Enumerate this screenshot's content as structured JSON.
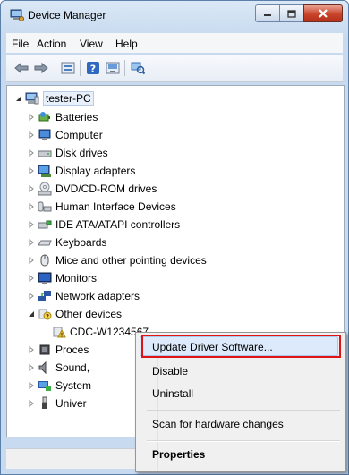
{
  "window": {
    "title": "Device Manager"
  },
  "menubar": [
    {
      "label": "File"
    },
    {
      "label": "Action"
    },
    {
      "label": "View"
    },
    {
      "label": "Help"
    }
  ],
  "toolbar": [
    {
      "icon": "back-arrow-icon"
    },
    {
      "icon": "forward-arrow-icon"
    },
    {
      "icon": "properties-icon"
    },
    {
      "icon": "help-icon"
    },
    {
      "icon": "update-driver-icon"
    },
    {
      "icon": "scan-hardware-icon"
    }
  ],
  "tree": {
    "root": "tester-PC",
    "items": [
      {
        "label": "Batteries",
        "icon": "battery-icon"
      },
      {
        "label": "Computer",
        "icon": "computer-icon"
      },
      {
        "label": "Disk drives",
        "icon": "disk-drive-icon"
      },
      {
        "label": "Display adapters",
        "icon": "display-adapter-icon"
      },
      {
        "label": "DVD/CD-ROM drives",
        "icon": "dvd-drive-icon"
      },
      {
        "label": "Human Interface Devices",
        "icon": "hid-icon"
      },
      {
        "label": "IDE ATA/ATAPI controllers",
        "icon": "ide-controller-icon"
      },
      {
        "label": "Keyboards",
        "icon": "keyboard-icon"
      },
      {
        "label": "Mice and other pointing devices",
        "icon": "mouse-icon"
      },
      {
        "label": "Monitors",
        "icon": "monitor-icon"
      },
      {
        "label": "Network adapters",
        "icon": "network-adapter-icon"
      },
      {
        "label": "Other devices",
        "icon": "unknown-device-icon",
        "expanded": true
      },
      {
        "label": "CDC-W1234567",
        "icon": "warning-device-icon",
        "child": true
      },
      {
        "label": "Proces",
        "icon": "processor-icon"
      },
      {
        "label": "Sound,",
        "icon": "sound-icon"
      },
      {
        "label": "System",
        "icon": "system-device-icon"
      },
      {
        "label": "Univer",
        "icon": "usb-icon"
      }
    ]
  },
  "context_menu": {
    "items": [
      {
        "label": "Update Driver Software..."
      },
      {
        "label": "Disable"
      },
      {
        "label": "Uninstall"
      },
      {
        "label": "Scan for hardware changes"
      },
      {
        "label": "Properties",
        "bold": true
      }
    ]
  },
  "colors": {
    "highlight_border": "#e01414",
    "title_bar": "#c7daef",
    "close_button": "#c9432a"
  }
}
